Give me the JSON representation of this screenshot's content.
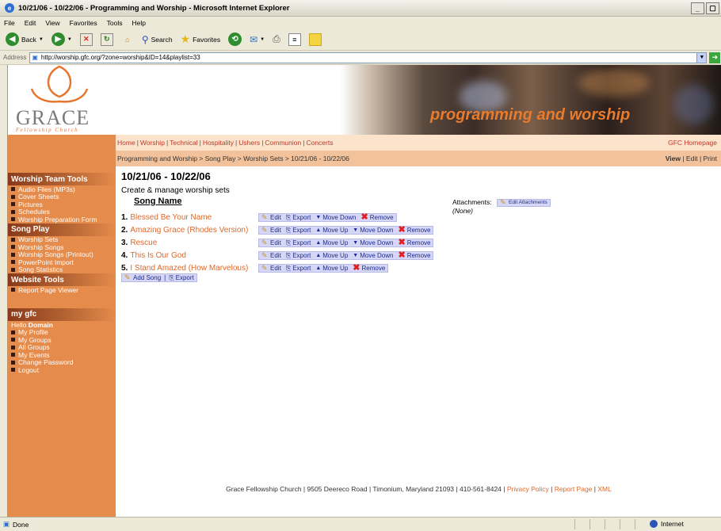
{
  "window": {
    "title": "10/21/06 - 10/22/06 - Programming and Worship - Microsoft Internet Explorer",
    "menu": [
      "File",
      "Edit",
      "View",
      "Favorites",
      "Tools",
      "Help"
    ],
    "toolbar": {
      "back": "Back",
      "search": "Search",
      "favorites": "Favorites"
    },
    "address_label": "Address",
    "address_value": "http://worship.gfc.org/?zone=worship&ID=14&playlist=33",
    "go_label": "Go",
    "status": "Done",
    "zone": "Internet"
  },
  "banner": {
    "logo_text": "GRACE",
    "logo_sub": "Fellowship Church",
    "title": "programming and worship"
  },
  "nav": {
    "items": [
      "Home",
      "Worship",
      "Technical",
      "Hospitality",
      "Ushers",
      "Communion",
      "Concerts"
    ],
    "home_link": "GFC Homepage"
  },
  "breadcrumb": {
    "path": "Programming and Worship > Song Play > Worship Sets > 10/21/06 - 10/22/06",
    "view": "View",
    "edit": "Edit",
    "print": "Print"
  },
  "sidebar": {
    "sections": [
      {
        "title": "Worship Team Tools",
        "items": [
          "Audio Files (MP3s)",
          "Cover Sheets",
          "Pictures",
          "Schedules",
          "Worship Preparation Form"
        ]
      },
      {
        "title": "Song Play",
        "items": [
          "Worship Sets",
          "Worship Songs",
          "Worship Songs (Printout)",
          "PowerPoint Import",
          "Song Statistics"
        ]
      },
      {
        "title": "Website Tools",
        "items": [
          "Report Page Viewer"
        ]
      },
      {
        "title": "my gfc",
        "items": [
          "My Profile",
          "My Groups",
          "All Groups",
          "My Events",
          "Change Password",
          "Logout"
        ]
      }
    ],
    "hello_prefix": "Hello",
    "hello_name": "Domain"
  },
  "main": {
    "heading": "10/21/06 - 10/22/06",
    "subheading": "Create & manage worship sets",
    "column_header": "Song Name",
    "actions": {
      "edit": "Edit",
      "export": "Export",
      "move_up": "Move Up",
      "move_down": "Move Down",
      "remove": "Remove"
    },
    "songs": [
      {
        "num": "1.",
        "name": "Blessed Be Your Name"
      },
      {
        "num": "2.",
        "name": "Amazing Grace (Rhodes Version)"
      },
      {
        "num": "3.",
        "name": "Rescue"
      },
      {
        "num": "4.",
        "name": "This Is Our God"
      },
      {
        "num": "5.",
        "name": "I Stand Amazed (How Marvelous)"
      }
    ],
    "add_song": "Add Song",
    "export_all": "Export",
    "attachments_label": "Attachments:",
    "edit_attachments": "Edit Attachments",
    "attachments_none": "(None)"
  },
  "footer": {
    "text": "Grace Fellowship Church | 9505 Deereco Road | Timonium, Maryland 21093 | 410-561-8424 |",
    "privacy": "Privacy Policy",
    "report": "Report Page",
    "xml": "XML"
  }
}
